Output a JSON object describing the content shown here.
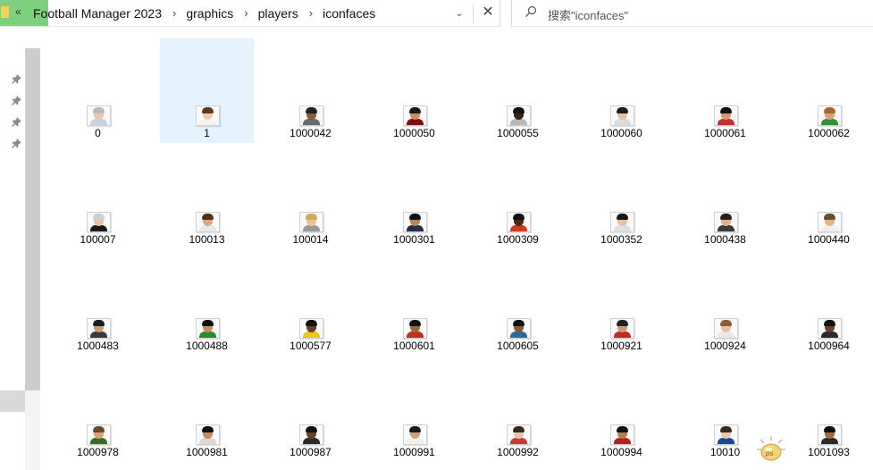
{
  "address_bar": {
    "back_glyph": "«",
    "crumbs": [
      "Football Manager 2023",
      "graphics",
      "players",
      "iconfaces"
    ],
    "separator": "›",
    "dropdown_glyph": "⌄",
    "close_glyph": "✕"
  },
  "search": {
    "placeholder": "搜索\"iconfaces\"",
    "icon": "search-icon"
  },
  "nav": {
    "pin_icon": "pin-icon",
    "pin_glyph": "📌",
    "pins": 4
  },
  "files": [
    {
      "name": "0",
      "skin": "#e9c6b0",
      "hair": "#b9b9b9",
      "shirt": "#c9d3e0"
    },
    {
      "name": "1",
      "skin": "#f0caa8",
      "hair": "#5a3a22",
      "shirt": "#f2f2f2",
      "selected": true
    },
    {
      "name": "1000042",
      "skin": "#8a5a3a",
      "hair": "#222222",
      "shirt": "#6a6a6a"
    },
    {
      "name": "1000050",
      "skin": "#c98f66",
      "hair": "#1a1a1a",
      "shirt": "#7a1010"
    },
    {
      "name": "1000055",
      "skin": "#3a2214",
      "hair": "#111111",
      "shirt": "#b8b8b8"
    },
    {
      "name": "1000060",
      "skin": "#e6c0a0",
      "hair": "#1e1e1e",
      "shirt": "#dcdcdc"
    },
    {
      "name": "1000061",
      "skin": "#d29b72",
      "hair": "#111111",
      "shirt": "#c43030"
    },
    {
      "name": "1000062",
      "skin": "#d9a27a",
      "hair": "#a86a2a",
      "shirt": "#3a8a3a"
    },
    {
      "name": "100007",
      "skin": "#e8c2a4",
      "hair": "#cfcfcf",
      "shirt": "#1a1a1a"
    },
    {
      "name": "100013",
      "skin": "#d9a882",
      "hair": "#4a3020",
      "shirt": "#e8e8e8"
    },
    {
      "name": "100014",
      "skin": "#e9c29c",
      "hair": "#d1a85a",
      "shirt": "#9a9a9a"
    },
    {
      "name": "1000301",
      "skin": "#b9825a",
      "hair": "#111111",
      "shirt": "#2a2a4a"
    },
    {
      "name": "1000309",
      "skin": "#4a2a18",
      "hair": "#111111",
      "shirt": "#cc3a20"
    },
    {
      "name": "1000352",
      "skin": "#e6c2a2",
      "hair": "#161616",
      "shirt": "#e0e0e0"
    },
    {
      "name": "1000438",
      "skin": "#e1b08a",
      "hair": "#222222",
      "shirt": "#3a3a3a"
    },
    {
      "name": "1000440",
      "skin": "#e0b48e",
      "hair": "#6a4a30",
      "shirt": "#f0f0f0"
    },
    {
      "name": "1000483",
      "skin": "#c89a74",
      "hair": "#1a1a1a",
      "shirt": "#3a3a3a"
    },
    {
      "name": "1000488",
      "skin": "#c88c5e",
      "hair": "#111111",
      "shirt": "#2a8a3a"
    },
    {
      "name": "1000577",
      "skin": "#6a3e22",
      "hair": "#111111",
      "shirt": "#e8c81a"
    },
    {
      "name": "1000601",
      "skin": "#9a6644",
      "hair": "#111111",
      "shirt": "#c03020"
    },
    {
      "name": "1000605",
      "skin": "#8a5836",
      "hair": "#111111",
      "shirt": "#2a6a9a"
    },
    {
      "name": "1000921",
      "skin": "#d09a70",
      "hair": "#222222",
      "shirt": "#c02a2a"
    },
    {
      "name": "1000924",
      "skin": "#e6c0a4",
      "hair": "#8a5a3a",
      "shirt": "#e8e8e8"
    },
    {
      "name": "1000964",
      "skin": "#6a4026",
      "hair": "#111111",
      "shirt": "#2a2a2a"
    },
    {
      "name": "1000978",
      "skin": "#d8a27a",
      "hair": "#6a4a2a",
      "shirt": "#3a6a2a"
    },
    {
      "name": "1000981",
      "skin": "#c48c62",
      "hair": "#111111",
      "shirt": "#d8d8d8"
    },
    {
      "name": "1000987",
      "skin": "#6a4228",
      "hair": "#111111",
      "shirt": "#2a2a2a"
    },
    {
      "name": "1000991",
      "skin": "#cfa07a",
      "hair": "#1a1a1a",
      "shirt": "#f0f0f0"
    },
    {
      "name": "1000992",
      "skin": "#e8c4a6",
      "hair": "#3a2a1a",
      "shirt": "#c83a3a"
    },
    {
      "name": "1000994",
      "skin": "#b87a52",
      "hair": "#111111",
      "shirt": "#b02020"
    },
    {
      "name": "10010",
      "skin": "#e8c6a8",
      "hair": "#3a2a1a",
      "shirt": "#1a4a9a"
    },
    {
      "name": "1001093",
      "skin": "#a06a44",
      "hair": "#111111",
      "shirt": "#2a2a2a"
    }
  ],
  "sticker": {
    "text": "ps",
    "icon": "sun-sticker-icon"
  }
}
